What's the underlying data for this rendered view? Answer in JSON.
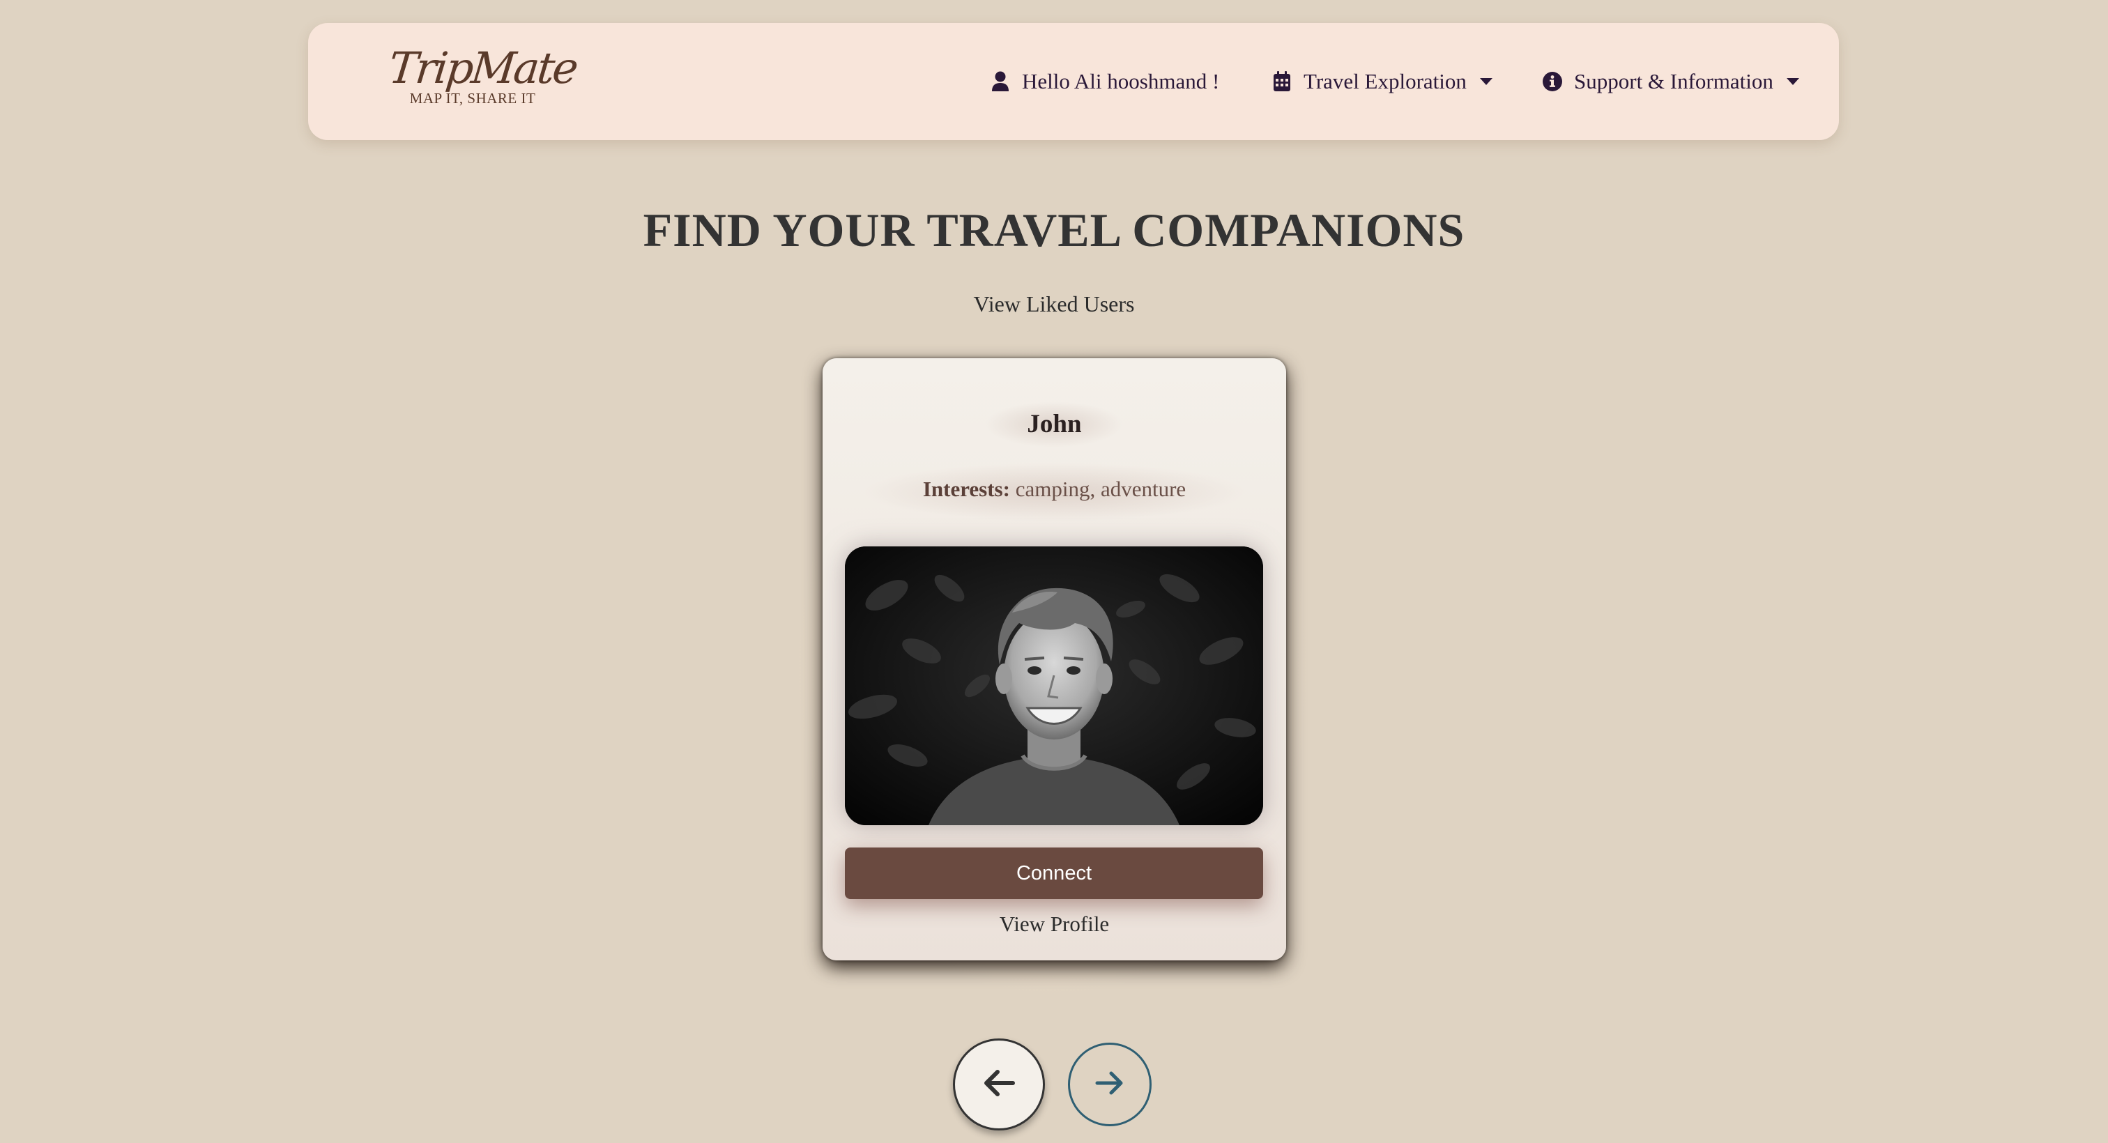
{
  "nav": {
    "logo_text": "TripMate",
    "logo_tagline": "MAP IT, SHARE IT",
    "user_greeting": "Hello Ali hooshmand !",
    "travel_menu_label": "Travel Exploration",
    "support_menu_label": "Support & Information",
    "icons": {
      "user": "user-icon",
      "calendar": "calendar-icon",
      "info": "info-icon",
      "caret": "caret-down-icon"
    }
  },
  "main": {
    "title": "FIND YOUR TRAVEL COMPANIONS",
    "liked_users_link": "View Liked Users"
  },
  "card": {
    "name": "John",
    "interests_label": "Interests:",
    "interests_value": " camping, adventure",
    "photo_alt": "Portrait of John",
    "connect_label": "Connect",
    "view_profile_label": "View Profile"
  },
  "carousel": {
    "prev_icon": "arrow-left-icon",
    "next_icon": "arrow-right-icon"
  },
  "colors": {
    "page_background": "#dfd3c2",
    "navbar_background": "#f8e5da",
    "connect_button": "#6a4a40",
    "next_arrow_accent": "#2f5f73"
  }
}
